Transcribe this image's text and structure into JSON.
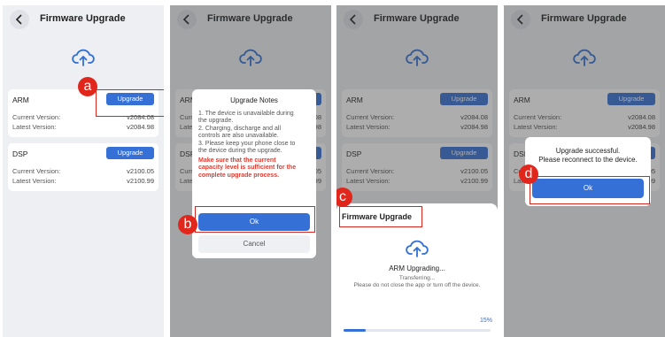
{
  "firmware": {
    "title": "Firmware Upgrade",
    "arm": {
      "name": "ARM",
      "current_label": "Current Version:",
      "current_value": "v2084.08",
      "latest_label": "Latest Version:",
      "latest_value": "v2084.98",
      "button_label": "Upgrade"
    },
    "dsp": {
      "name": "DSP",
      "current_label": "Current Version:",
      "current_value": "v2100.05",
      "latest_label": "Latest Version:",
      "latest_value": "v2100.99",
      "button_label": "Upgrade"
    }
  },
  "notes_dialog": {
    "title": "Upgrade Notes",
    "body_lines": [
      "1. The device is unavailable during",
      "the upgrade.",
      "2. Charging, discharge and all",
      "controls are also unavailable.",
      "3. Please keep your phone close to",
      "the device during the upgrade."
    ],
    "warning_lines": [
      "Make sure that the current",
      "capacity level is sufficient for the",
      "complete upgrade process."
    ],
    "ok_label": "Ok",
    "cancel_label": "Cancel"
  },
  "progress_sheet": {
    "title": "Firmware Upgrade",
    "status": "ARM Upgrading...",
    "substatus": "Transferring...",
    "hint": "Please do not close the app or turn off the device.",
    "percent_label": "15%",
    "progress": 0.15
  },
  "success_dialog": {
    "line1": "Upgrade successful.",
    "line2": "Please reconnect to the device.",
    "ok_label": "Ok"
  },
  "markers": {
    "a": "a",
    "b": "b",
    "c": "c",
    "d": "d"
  },
  "colors": {
    "accent": "#3570d6",
    "highlight": "#d7261e",
    "warning": "#e23a2e"
  }
}
